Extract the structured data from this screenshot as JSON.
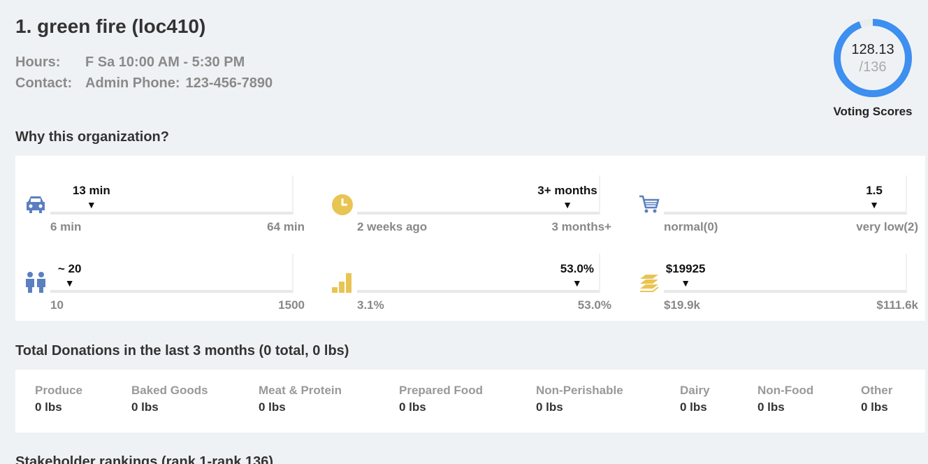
{
  "header": {
    "title": "1. green fire (loc410)",
    "hours_label": "Hours:",
    "hours_value": "F Sa 10:00 AM - 5:30 PM",
    "contact_label": "Contact:",
    "contact_type": "Admin Phone:",
    "contact_value": "123-456-7890"
  },
  "score": {
    "value": "128.13",
    "max": "/136",
    "fraction": 0.942,
    "label": "Voting Scores",
    "ring_color": "#3d8ff0",
    "track_color": "#e9edf0"
  },
  "why": {
    "title": "Why this organization?",
    "metrics": [
      {
        "icon": "car-icon",
        "value": "13 min",
        "low": "6 min",
        "high": "64 min",
        "position": 0.17
      },
      {
        "icon": "clock-icon",
        "value": "3+ months",
        "low": "2 weeks ago",
        "high": "3 months+",
        "position": 0.87
      },
      {
        "icon": "cart-icon",
        "value": "1.5",
        "low": "normal(0)",
        "high": "very low(2)",
        "position": 0.87
      },
      {
        "icon": "people-icon",
        "value": "~ 20",
        "low": "10",
        "high": "1500",
        "position": 0.08
      },
      {
        "icon": "bar-chart-icon",
        "value": "53.0%",
        "low": "3.1%",
        "high": "53.0%",
        "position": 0.91
      },
      {
        "icon": "money-stack-icon",
        "value": "$19925",
        "low": "$19.9k",
        "high": "$111.6k",
        "position": 0.09
      }
    ]
  },
  "donations": {
    "title": "Total Donations in the last 3 months (0 total, 0 lbs)",
    "items": [
      {
        "label": "Produce",
        "value": "0 lbs"
      },
      {
        "label": "Baked Goods",
        "value": "0 lbs"
      },
      {
        "label": "Meat & Protein",
        "value": "0 lbs"
      },
      {
        "label": "Prepared Food",
        "value": "0 lbs"
      },
      {
        "label": "Non-Perishable",
        "value": "0 lbs"
      },
      {
        "label": "Dairy",
        "value": "0 lbs"
      },
      {
        "label": "Non-Food",
        "value": "0 lbs"
      },
      {
        "label": "Other",
        "value": "0 lbs"
      }
    ]
  },
  "stakeholder": {
    "title": "Stakeholder rankings (rank 1-rank 136)"
  },
  "colors": {
    "icon_blue": "#5b7fc0",
    "icon_gold": "#e8c452"
  }
}
